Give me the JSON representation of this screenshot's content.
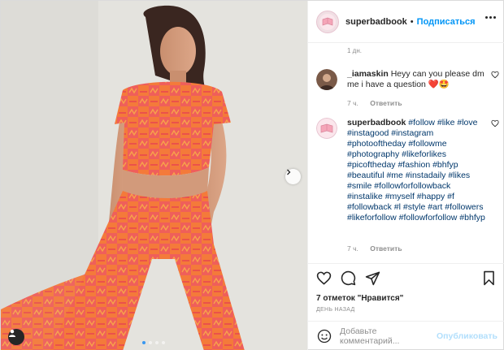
{
  "post": {
    "username": "superbadbook",
    "separator": "•",
    "follow_label": "Подписаться",
    "caption_time": "1 дн.",
    "photo_dots": 4,
    "photo_active_index": 0
  },
  "comments": [
    {
      "username": "_iamaskin",
      "text": "Heyy can you please dm me i have a question ❤️🤩",
      "time": "7 ч.",
      "reply_label": "Ответить"
    },
    {
      "username": "superbadbook",
      "hashtags": "#follow #like #love #instagood #instagram #photooftheday #followme #photography #likeforlikes #picoftheday #fashion #bhfyp #beautiful #me #instadaily #likes #smile #followforfollowback #instalike #myself #happy #f #followback #l #style #art #followers #likeforfollow #followforfollow #bhfyp",
      "time": "7 ч.",
      "reply_label": "Ответить"
    }
  ],
  "actions": {
    "like_icon": "heart-icon",
    "comment_icon": "comment-icon",
    "share_icon": "paper-plane-icon",
    "save_icon": "bookmark-icon"
  },
  "likes_text": "7 отметок \"Нравится\"",
  "date_text": "ДЕНЬ НАЗАД",
  "add_comment": {
    "placeholder": "Добавьте комментарий...",
    "publish_label": "Опубликовать",
    "emoji_icon": "emoji-icon"
  },
  "colors": {
    "link_blue": "#0095f6",
    "hashtag": "#00376b",
    "muted": "#8e8e8e",
    "publish_disabled": "#b2dffc"
  }
}
